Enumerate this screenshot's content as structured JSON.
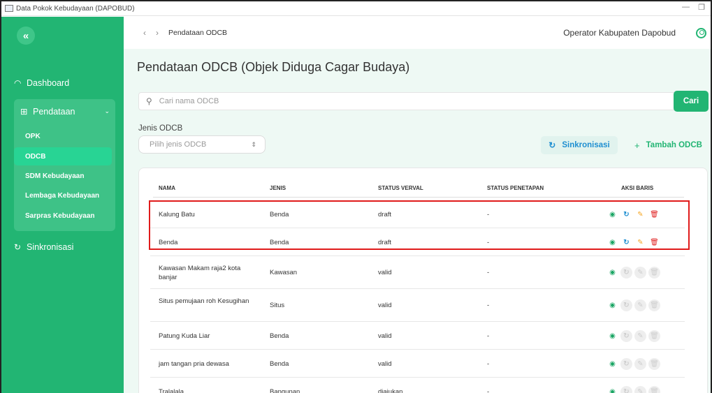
{
  "window": {
    "title": "Data Pokok Kebudayaan (DAPOBUD)",
    "minimize": "—",
    "restore": "❐"
  },
  "sidebar": {
    "collapse_icon": "«",
    "dashboard": {
      "label": "Dashboard",
      "icon": "◠"
    },
    "pendataan": {
      "label": "Pendataan",
      "icon": "⊞",
      "chevron": "⌄",
      "items": [
        {
          "label": "OPK"
        },
        {
          "label": "ODCB",
          "active": true
        },
        {
          "label": "SDM Kebudayaan"
        },
        {
          "label": "Lembaga Kebudayaan"
        },
        {
          "label": "Sarpras Kebudayaan"
        }
      ]
    },
    "sinkronisasi": {
      "label": "Sinkronisasi",
      "icon": "↻"
    }
  },
  "header": {
    "back": "‹",
    "forward": "›",
    "breadcrumb": "Pendataan ODCB",
    "user": "Operator Kabupaten Dapobud"
  },
  "main": {
    "title": "Pendataan ODCB (Objek Diduga Cagar Budaya)",
    "search": {
      "placeholder": "Cari nama ODCB",
      "value": "",
      "button": "Cari",
      "icon": "⚲"
    },
    "filter": {
      "label": "Jenis ODCB",
      "placeholder": "Pilih jenis ODCB",
      "arrows": "⇕"
    },
    "sync_button": {
      "label": "Sinkronisasi",
      "icon": "↻"
    },
    "add_button": {
      "label": "Tambah ODCB",
      "icon": "+"
    },
    "table": {
      "columns": [
        "NAMA",
        "JENIS",
        "STATUS VERVAL",
        "STATUS PENETAPAN",
        "AKSI BARIS"
      ],
      "rows": [
        {
          "nama": "Kalung Batu",
          "jenis": "Benda",
          "verval": "draft",
          "penetapan": "-",
          "enabled": true
        },
        {
          "nama": "Benda",
          "jenis": "Benda",
          "verval": "draft",
          "penetapan": "-",
          "enabled": true
        },
        {
          "nama": "Kawasan Makam raja2 kota banjar",
          "jenis": "Kawasan",
          "verval": "valid",
          "penetapan": "-",
          "enabled": false
        },
        {
          "nama": "Situs pemujaan roh Kesugihan",
          "jenis": "Situs",
          "verval": "valid",
          "penetapan": "-",
          "enabled": false
        },
        {
          "nama": "Patung Kuda Liar",
          "jenis": "Benda",
          "verval": "valid",
          "penetapan": "-",
          "enabled": false
        },
        {
          "nama": "jam tangan pria dewasa",
          "jenis": "Benda",
          "verval": "valid",
          "penetapan": "-",
          "enabled": false
        },
        {
          "nama": "Tralalala",
          "jenis": "Bangunan",
          "verval": "diajukan",
          "penetapan": "-",
          "enabled": false
        }
      ],
      "action_icons": {
        "view": "eye-icon",
        "sync": "sync-icon",
        "edit": "edit-icon",
        "delete": "trash-icon"
      }
    }
  },
  "colors": {
    "sidebar": "#22b573",
    "group_bg": "#3ec287",
    "active_item": "#28d494",
    "main_bg": "#eef9f4",
    "accent_blue": "#1f8fd1",
    "edit": "#f5a623",
    "delete": "#e02424",
    "highlight": "#e01b1b"
  }
}
